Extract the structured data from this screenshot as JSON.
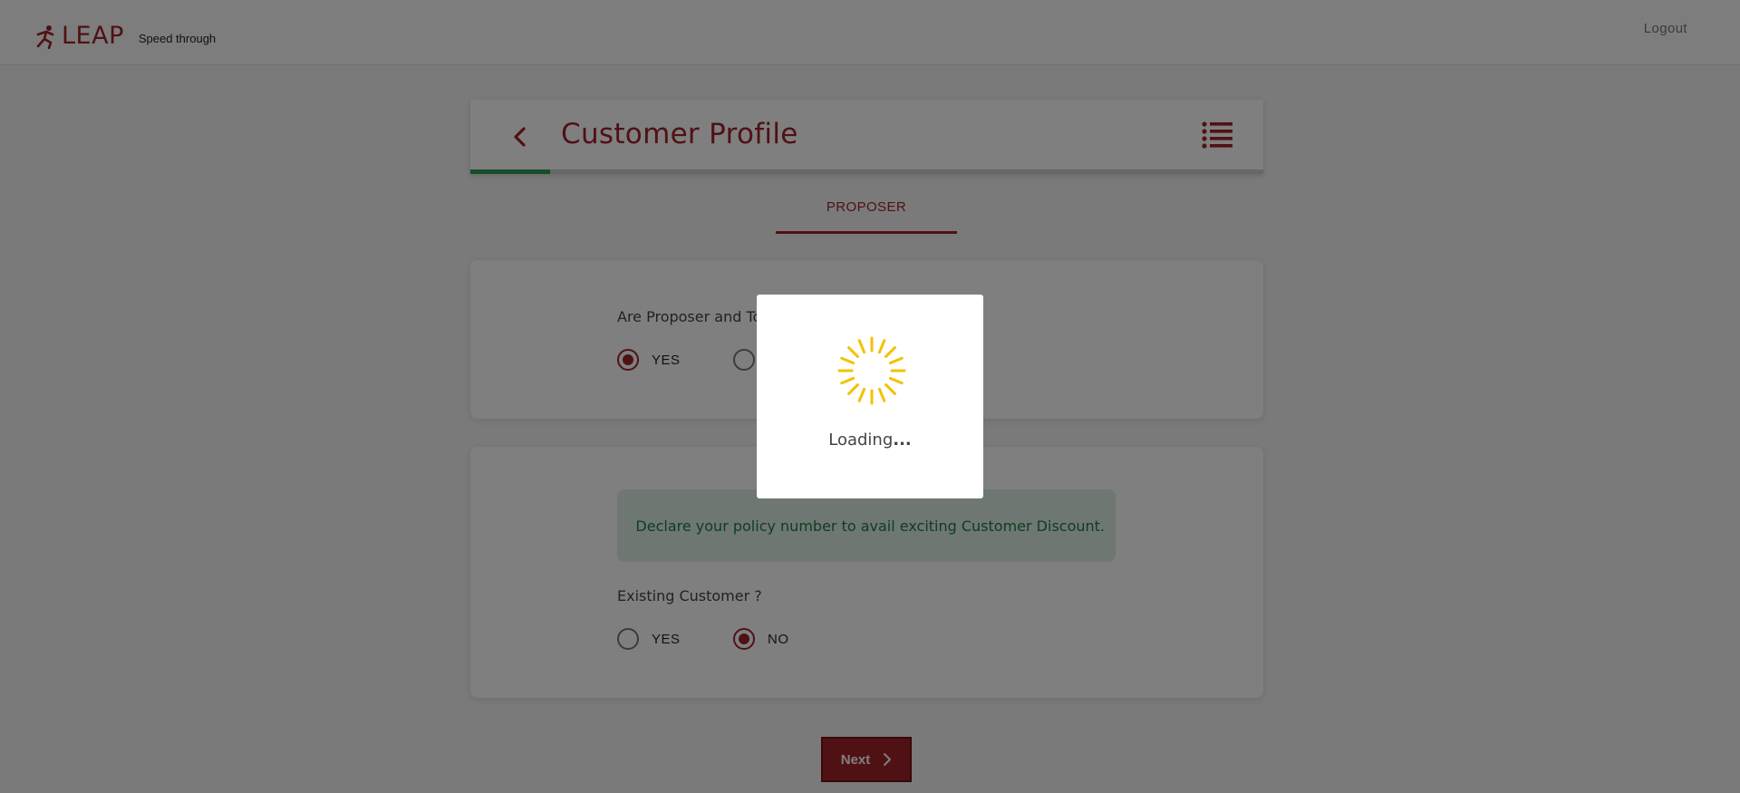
{
  "header": {
    "brand": "LEAP",
    "tagline": "Speed through",
    "logout_label": "Logout"
  },
  "page": {
    "title": "Customer Profile",
    "progress_fraction": 0.1,
    "tab_label": "PROPOSER"
  },
  "proposer_question": {
    "label": "Are Proposer and To B",
    "options": [
      {
        "label": "YES",
        "selected": true
      },
      {
        "label": "",
        "selected": false
      }
    ]
  },
  "existing_customer": {
    "info_text": "Declare your policy number to avail exciting Customer Discount.",
    "label": "Existing Customer ?",
    "options": [
      {
        "label": "YES",
        "selected": false
      },
      {
        "label": "NO",
        "selected": true
      }
    ]
  },
  "next_button": {
    "label": "Next"
  },
  "loading": {
    "text": "Loading",
    "dots": "..."
  },
  "colors": {
    "brand": "#a1232b",
    "progress": "#2f9a57",
    "info_bg": "#dcefe5",
    "info_text": "#1f7a43",
    "spinner": "#f2c200"
  }
}
